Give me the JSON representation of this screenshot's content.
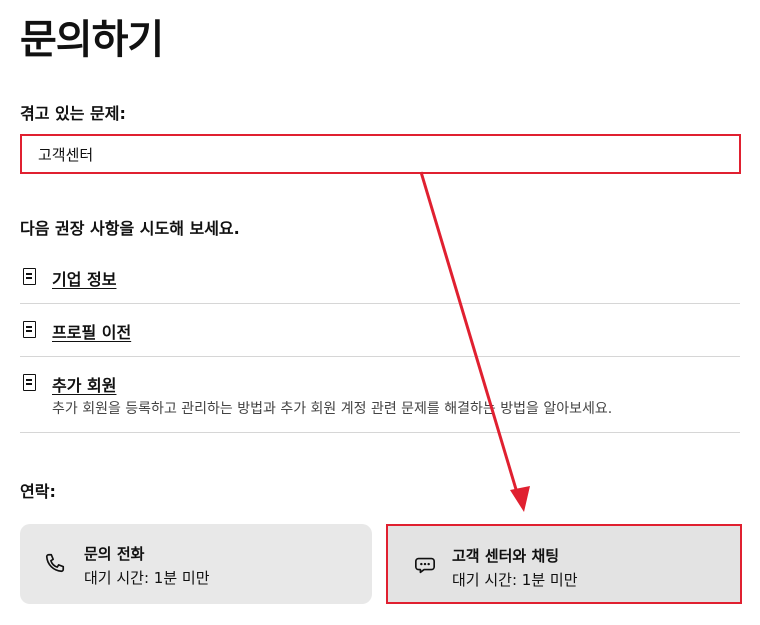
{
  "page": {
    "title": "문의하기"
  },
  "issue": {
    "label": "겪고 있는 문제:",
    "value": "고객센터"
  },
  "suggestions": {
    "heading": "다음 권장 사항을 시도해 보세요.",
    "items": [
      {
        "title": "기업 정보",
        "icon": "document-icon"
      },
      {
        "title": "프로필 이전",
        "icon": "document-icon"
      },
      {
        "title": "추가 회원",
        "description": "추가 회원을 등록하고 관리하는 방법과 추가 회원 계정 관련 문제를 해결하는 방법을 알아보세요.",
        "icon": "document-icon"
      }
    ]
  },
  "contact": {
    "heading": "연락:",
    "phone": {
      "title": "문의 전화",
      "subtitle": "대기 시간: 1분 미만",
      "icon": "phone-icon"
    },
    "chat": {
      "title": "고객 센터와 채팅",
      "subtitle": "대기 시간: 1분 미만",
      "icon": "chat-bubble-icon"
    }
  },
  "annotation_color": "#e02030"
}
